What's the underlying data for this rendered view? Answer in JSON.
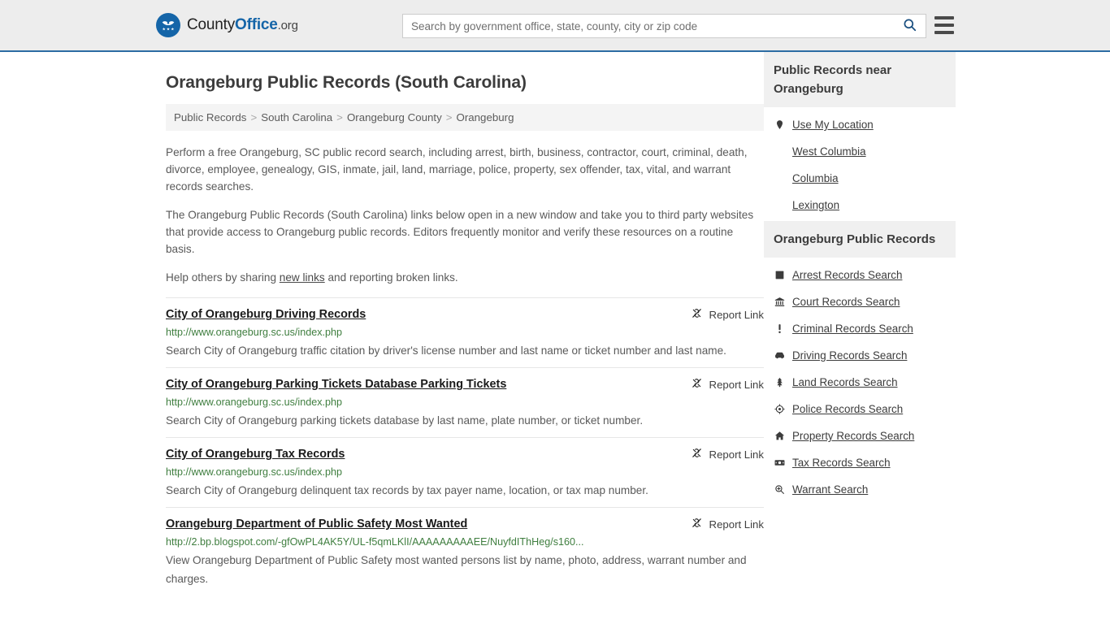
{
  "header": {
    "brand": {
      "county": "County",
      "office": "Office",
      "org": ".org",
      "icon": "eagle-seal-icon"
    },
    "search": {
      "placeholder": "Search by government office, state, county, city or zip code",
      "value": "",
      "button_icon": "search-icon"
    },
    "menu_icon": "hamburger-menu-icon",
    "accent_color": "#2c6ca3"
  },
  "page_title": "Orangeburg Public Records (South Carolina)",
  "breadcrumb": [
    {
      "label": "Public Records",
      "current": false
    },
    {
      "label": "South Carolina",
      "current": false
    },
    {
      "label": "Orangeburg County",
      "current": false
    },
    {
      "label": "Orangeburg",
      "current": true
    }
  ],
  "breadcrumb_separator": ">",
  "intro": {
    "p1": "Perform a free Orangeburg, SC public record search, including arrest, birth, business, contractor, court, criminal, death, divorce, employee, genealogy, GIS, inmate, jail, land, marriage, police, property, sex offender, tax, vital, and warrant records searches.",
    "p2": "The Orangeburg Public Records (South Carolina) links below open in a new window and take you to third party websites that provide access to Orangeburg public records. Editors frequently monitor and verify these resources on a routine basis.",
    "p3_before": "Help others by sharing ",
    "p3_link": "new links",
    "p3_after": " and reporting broken links."
  },
  "report_link_label": "Report Link",
  "report_link_icon": "broken-link-icon",
  "results": [
    {
      "title": "City of Orangeburg Driving Records",
      "url": "http://www.orangeburg.sc.us/index.php",
      "description": "Search City of Orangeburg traffic citation by driver's license number and last name or ticket number and last name."
    },
    {
      "title": "City of Orangeburg Parking Tickets Database Parking Tickets",
      "url": "http://www.orangeburg.sc.us/index.php",
      "description": "Search City of Orangeburg parking tickets database by last name, plate number, or ticket number."
    },
    {
      "title": "City of Orangeburg Tax Records",
      "url": "http://www.orangeburg.sc.us/index.php",
      "description": "Search City of Orangeburg delinquent tax records by tax payer name, location, or tax map number."
    },
    {
      "title": "Orangeburg Department of Public Safety Most Wanted",
      "url": "http://2.bp.blogspot.com/-gfOwPL4AK5Y/UL-f5qmLKlI/AAAAAAAAAEE/NuyfdIThHeg/s160...",
      "description": "View Orangeburg Department of Public Safety most wanted persons list by name, photo, address, warrant number and charges."
    }
  ],
  "sidebar": {
    "near_box": {
      "heading": "Public Records near Orangeburg",
      "items": [
        {
          "label": "Use My Location",
          "icon": "map-pin-icon"
        },
        {
          "label": "West Columbia",
          "icon": "none"
        },
        {
          "label": "Columbia",
          "icon": "none"
        },
        {
          "label": "Lexington",
          "icon": "none"
        }
      ]
    },
    "records_box": {
      "heading": "Orangeburg Public Records",
      "items": [
        {
          "label": "Arrest Records Search",
          "icon": "square-icon"
        },
        {
          "label": "Court Records Search",
          "icon": "bank-icon"
        },
        {
          "label": "Criminal Records Search",
          "icon": "exclamation-icon"
        },
        {
          "label": "Driving Records Search",
          "icon": "car-icon"
        },
        {
          "label": "Land Records Search",
          "icon": "tree-icon"
        },
        {
          "label": "Police Records Search",
          "icon": "badge-target-icon"
        },
        {
          "label": "Property Records Search",
          "icon": "home-icon"
        },
        {
          "label": "Tax Records Search",
          "icon": "money-icon"
        },
        {
          "label": "Warrant Search",
          "icon": "magnifier-plus-icon"
        }
      ]
    }
  }
}
